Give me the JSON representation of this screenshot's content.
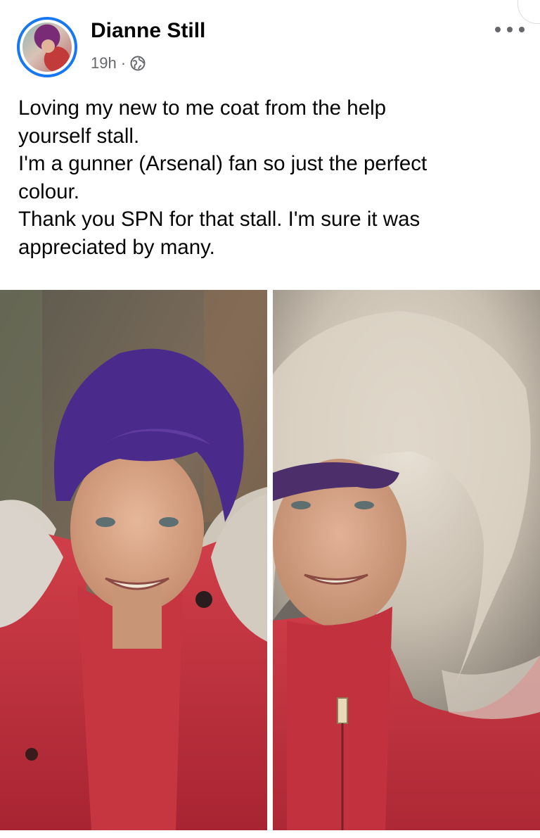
{
  "post": {
    "author": "Dianne Still",
    "time": "19h",
    "separator": "·",
    "audience_icon": "globe-icon",
    "more_icon": "more-horizontal-icon",
    "text": "Loving my new to me coat from the help\nyourself stall.\nI'm a gunner (Arsenal) fan so just the perfect\ncolour.\nThank you SPN for that stall. I'm sure it was\nappreciated by many."
  },
  "photos": [
    {
      "name": "photo-left",
      "content": "selfie-purple-hair-red-coat"
    },
    {
      "name": "photo-right",
      "content": "selfie-fur-hood-red-coat"
    }
  ],
  "colors": {
    "accent": "#1877f2",
    "secondary_text": "#65676b",
    "coat_red": "#c8333d",
    "hair_purple": "#4a2a8a",
    "fur": "#d8cfc3"
  }
}
